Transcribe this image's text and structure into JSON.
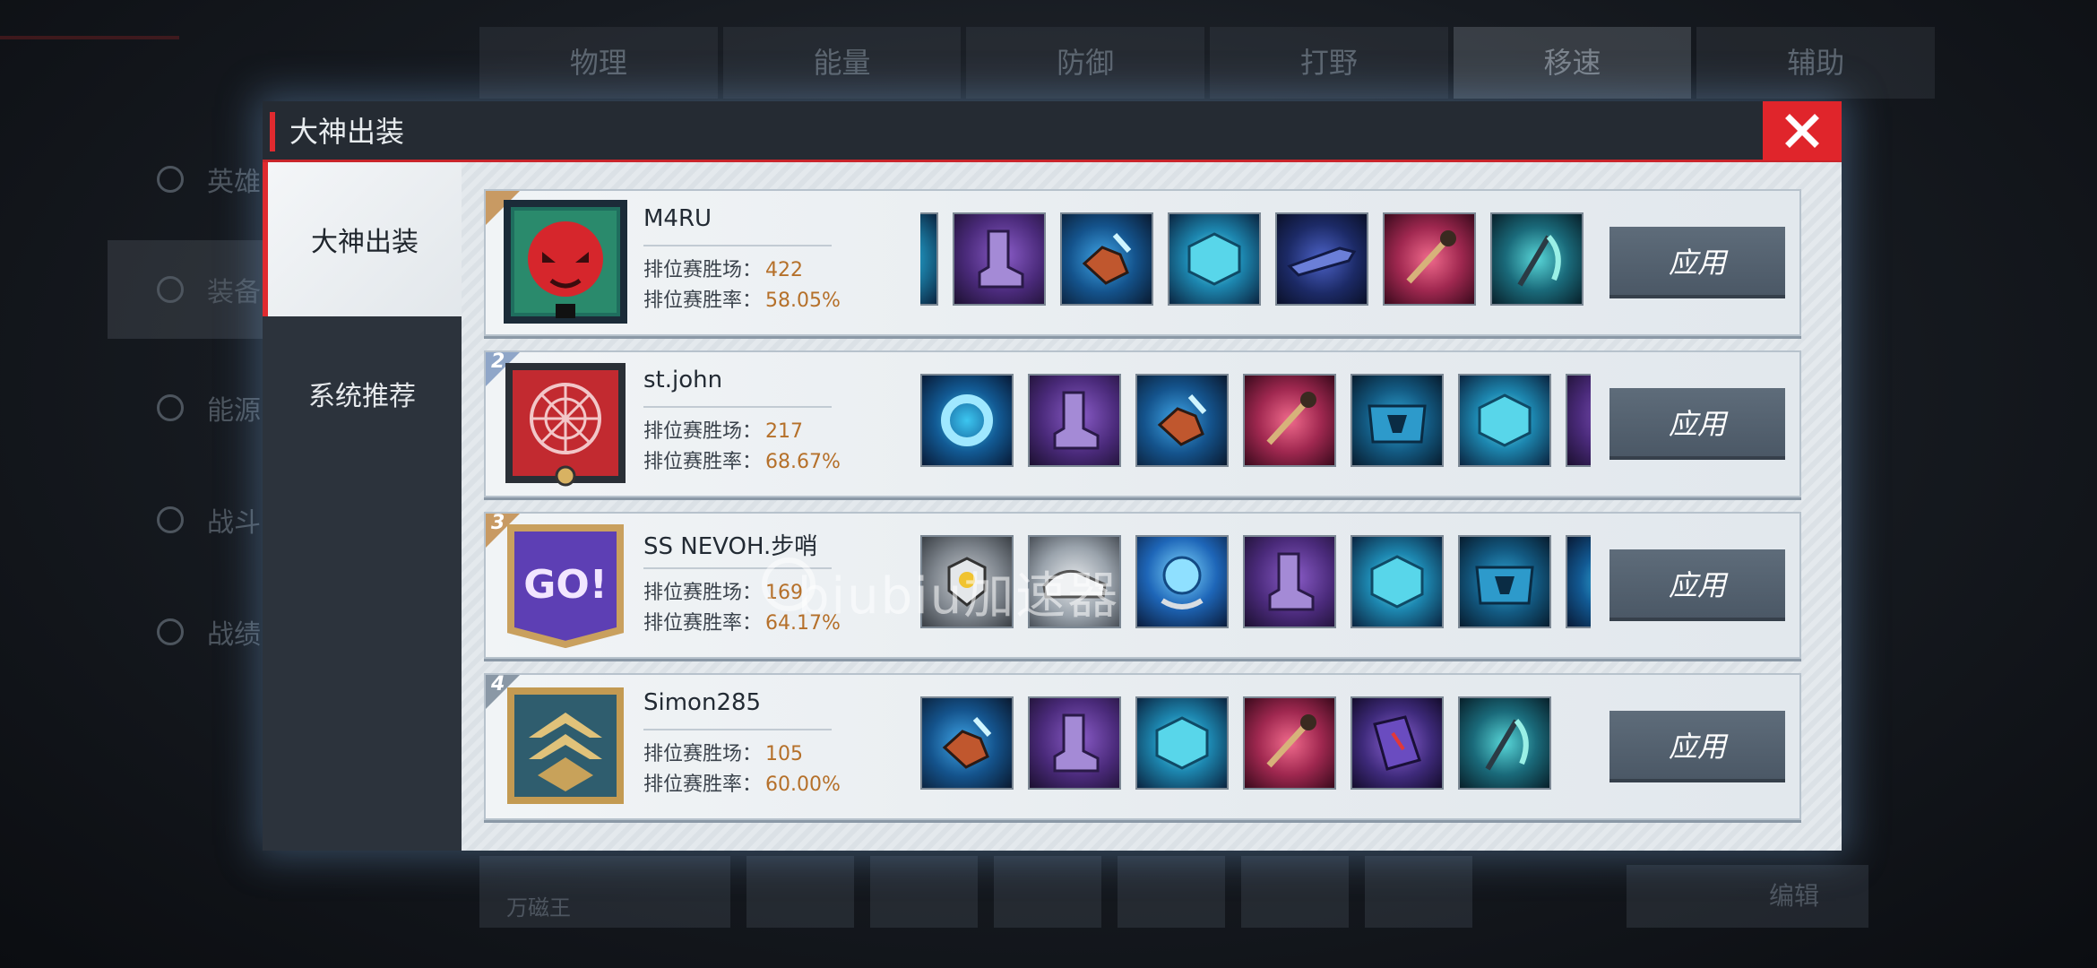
{
  "background": {
    "tabs": [
      "物理",
      "能量",
      "防御",
      "打野",
      "移速",
      "辅助"
    ],
    "active_tab_index": 4,
    "sidebar": [
      "英雄",
      "装备",
      "能源",
      "战斗",
      "战绩"
    ],
    "bottom_first_label": "万磁王",
    "edit_label": "编辑"
  },
  "modal": {
    "title": "大神出装",
    "close_icon": "close-icon",
    "accent_color": "#e02a2f",
    "sidebar_tabs": [
      {
        "label": "大神出装",
        "active": true
      },
      {
        "label": "系统推荐",
        "active": false
      }
    ]
  },
  "builds": [
    {
      "rank": "",
      "player": "M4RU",
      "wins_label": "排位赛胜场：",
      "wins": "422",
      "rate_label": "排位赛胜率：",
      "rate": "58.05%",
      "avatar": "red-panther-avatar",
      "items": [
        "cube-item",
        "boots-item",
        "gauntlet-item",
        "cube-item",
        "rifle-item",
        "staff-item",
        "scythe-item"
      ],
      "apply": "应用"
    },
    {
      "rank": "2",
      "player": "st.john",
      "wins_label": "排位赛胜场：",
      "wins": "217",
      "rate_label": "排位赛胜率：",
      "rate": "68.67%",
      "avatar": "spider-emblem-avatar",
      "items": [
        "ring-item",
        "boots-item",
        "gauntlet-item",
        "staff-item",
        "chest-item",
        "cube-item",
        "boots-item"
      ],
      "apply": "应用"
    },
    {
      "rank": "3",
      "player": "SS NEVOH.步哨",
      "wins_label": "排位赛胜场：",
      "wins": "169",
      "rate_label": "排位赛胜率：",
      "rate": "64.17%",
      "avatar": "go-pixel-avatar",
      "items": [
        "badge-item",
        "shoe-item",
        "orb-item",
        "boots-item",
        "cube-item",
        "chest-item",
        "ring-item"
      ],
      "apply": "应用"
    },
    {
      "rank": "4",
      "player": "Simon285",
      "wins_label": "排位赛胜场：",
      "wins": "105",
      "rate_label": "排位赛胜率：",
      "rate": "60.00%",
      "avatar": "gold-chevron-avatar",
      "items": [
        "gauntlet-item",
        "boots-item",
        "cube-item",
        "staff-item",
        "book-item",
        "scythe-item"
      ],
      "apply": "应用"
    }
  ],
  "watermark": "biubiu加速器"
}
